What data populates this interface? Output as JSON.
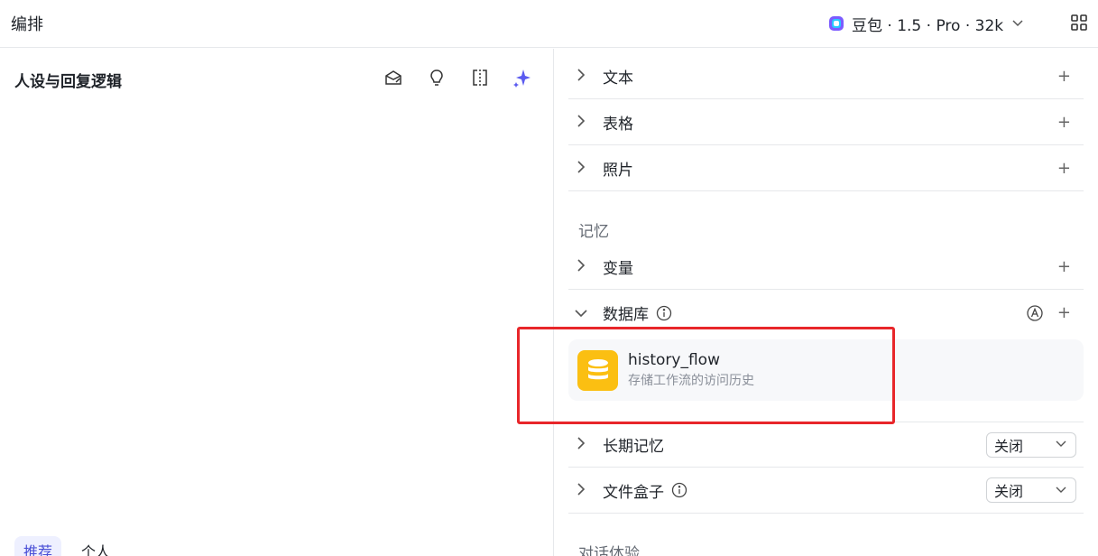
{
  "topbar": {
    "title": "编排",
    "model": {
      "label": "豆包 · 1.5 · Pro · 32k",
      "logo_icon": "doubao-logo-icon"
    },
    "layout_icon": "grid-layout-icon"
  },
  "left": {
    "title": "人设与回复逻辑",
    "tools": [
      "prompt-library-icon",
      "lightbulb-icon",
      "compare-icon",
      "ai-sparkle-icon"
    ],
    "tabs": [
      {
        "label": "推荐",
        "active": true
      },
      {
        "label": "个人",
        "active": false
      }
    ]
  },
  "right": {
    "rows_top": [
      {
        "label": "文本"
      },
      {
        "label": "表格"
      },
      {
        "label": "照片"
      }
    ],
    "memory_section": "记忆",
    "variables": {
      "label": "变量"
    },
    "database": {
      "label": "数据库",
      "item": {
        "name": "history_flow",
        "desc": "存储工作流的访问历史"
      }
    },
    "long_memory": {
      "label": "长期记忆",
      "value": "关闭"
    },
    "file_box": {
      "label": "文件盒子",
      "value": "关闭"
    },
    "chat_section": "对话体验"
  },
  "colors": {
    "accent": "#4a4fd6",
    "db_icon_bg": "#fbbf12",
    "highlight": "#e8262a"
  }
}
